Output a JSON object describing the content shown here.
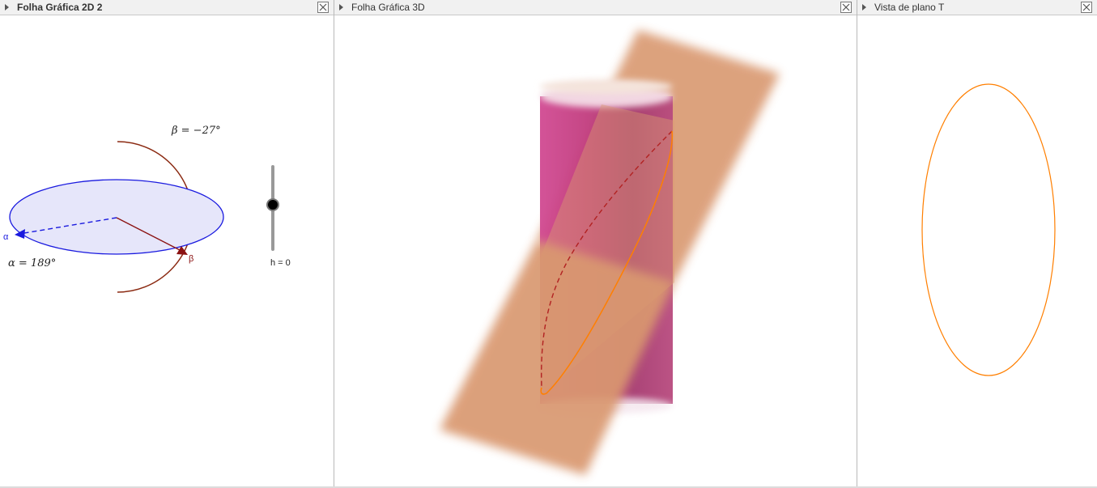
{
  "panels": [
    {
      "title": "Folha Gráfica 2D 2",
      "bold": true
    },
    {
      "title": "Folha Gráfica 3D",
      "bold": false
    },
    {
      "title": "Vista de plano T",
      "bold": false
    }
  ],
  "graphics2d": {
    "beta_label": "β = −27°",
    "alpha_label": "α = 189°",
    "alpha_point": "α",
    "beta_point": "β",
    "slider_label": "h = 0",
    "slider_value": 0
  },
  "colors": {
    "ellipse_fill": "#e6e6fa",
    "ellipse_stroke": "#1a1adf",
    "arc": "#8b2a12",
    "cylinder": "#c23d7f",
    "plane": "#d99870",
    "section": "#ff7f00"
  }
}
